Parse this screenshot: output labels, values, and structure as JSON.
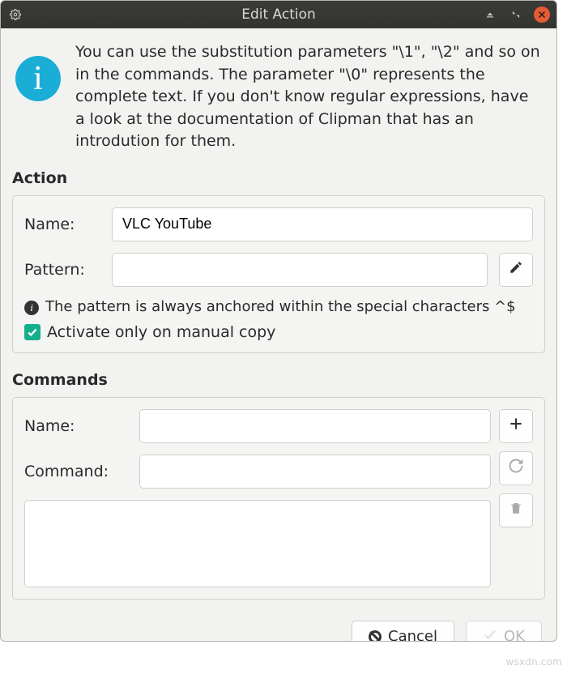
{
  "titlebar": {
    "title": "Edit Action"
  },
  "info": {
    "text": "You can use the substitution parameters \"\\1\", \"\\2\" and so on in the commands. The parameter \"\\0\" represents the complete text. If you don't know regular expressions, have a look at the documentation of Clipman that has an introdution for them."
  },
  "action": {
    "heading": "Action",
    "name_label": "Name:",
    "name_value": "VLC YouTube",
    "pattern_label": "Pattern:",
    "pattern_value": "",
    "hint": "The pattern is always anchored within the special characters ^$",
    "activate_label": "Activate only on manual copy",
    "activate_checked": true
  },
  "commands": {
    "heading": "Commands",
    "name_label": "Name:",
    "name_value": "",
    "command_label": "Command:",
    "command_value": ""
  },
  "buttons": {
    "cancel": "Cancel",
    "ok": "OK"
  },
  "watermark": "wsxdn.com"
}
